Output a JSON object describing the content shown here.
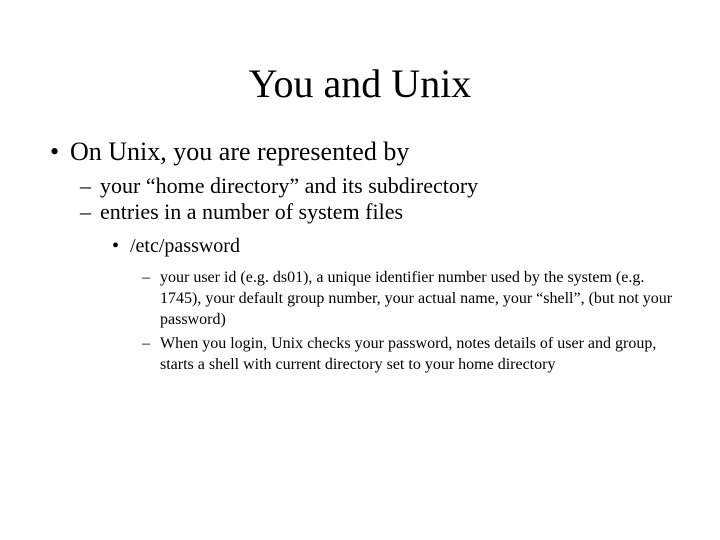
{
  "slide": {
    "title": "You and Unix",
    "bullet1": "On Unix, you are represented by",
    "sub1": "your “home directory” and its subdirectory",
    "sub2": "entries in a number of system files",
    "subsub1": "/etc/password",
    "detail1": "your user id (e.g. ds01), a unique identifier number used by the system  (e.g. 1745), your default group number, your actual name, your “shell”, (but not your password)",
    "detail2": "When you login, Unix checks your password, notes details of user and group, starts a shell with current directory set to your home directory"
  }
}
